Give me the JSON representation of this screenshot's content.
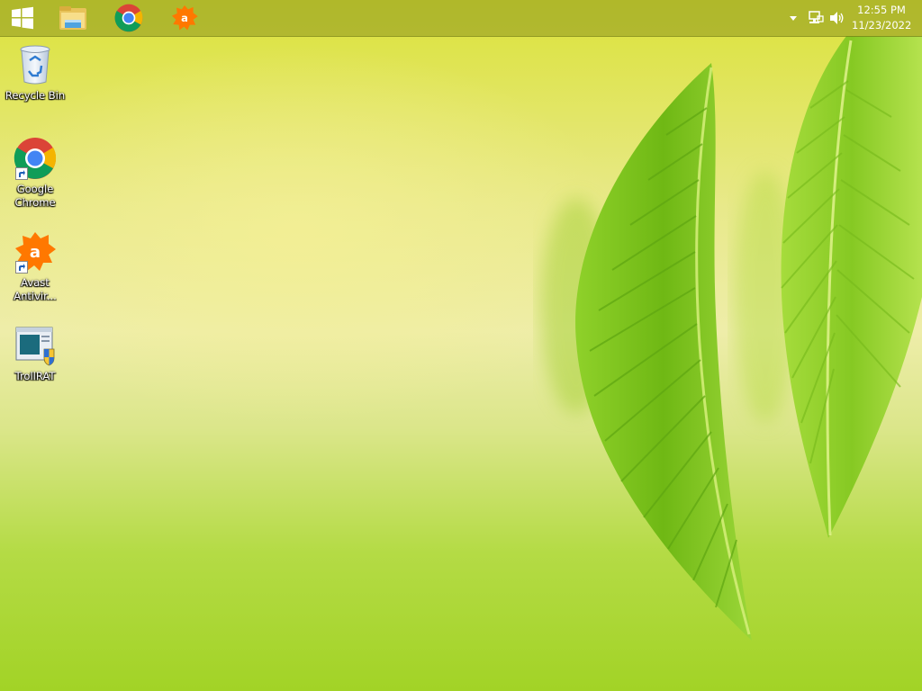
{
  "taskbar": {
    "pinned": [
      {
        "name": "start-button",
        "icon": "windows-logo-icon"
      },
      {
        "name": "file-explorer",
        "icon": "folder-icon"
      },
      {
        "name": "google-chrome",
        "icon": "chrome-icon"
      },
      {
        "name": "avast-antivirus",
        "icon": "avast-icon"
      }
    ],
    "tray": {
      "icons": [
        "chevron-up-icon",
        "network-icon",
        "volume-icon"
      ],
      "time": "12:55 PM",
      "date": "11/23/2022"
    }
  },
  "desktop": {
    "icons": [
      {
        "label": "Recycle Bin",
        "icon": "recycle-bin-icon"
      },
      {
        "label": "Google\nChrome",
        "icon": "chrome-icon"
      },
      {
        "label": "Avast\nAntivir...",
        "icon": "avast-icon"
      },
      {
        "label": "TrollRAT",
        "icon": "trollrat-icon"
      }
    ],
    "wallpaper": "green-leaves-wallpaper"
  },
  "colors": {
    "taskbar": "#8c961e",
    "wallpaper_top": "#dbe23a",
    "wallpaper_bottom": "#a2d326",
    "leaf": "#7cc21d",
    "avast_orange": "#ff7800"
  }
}
